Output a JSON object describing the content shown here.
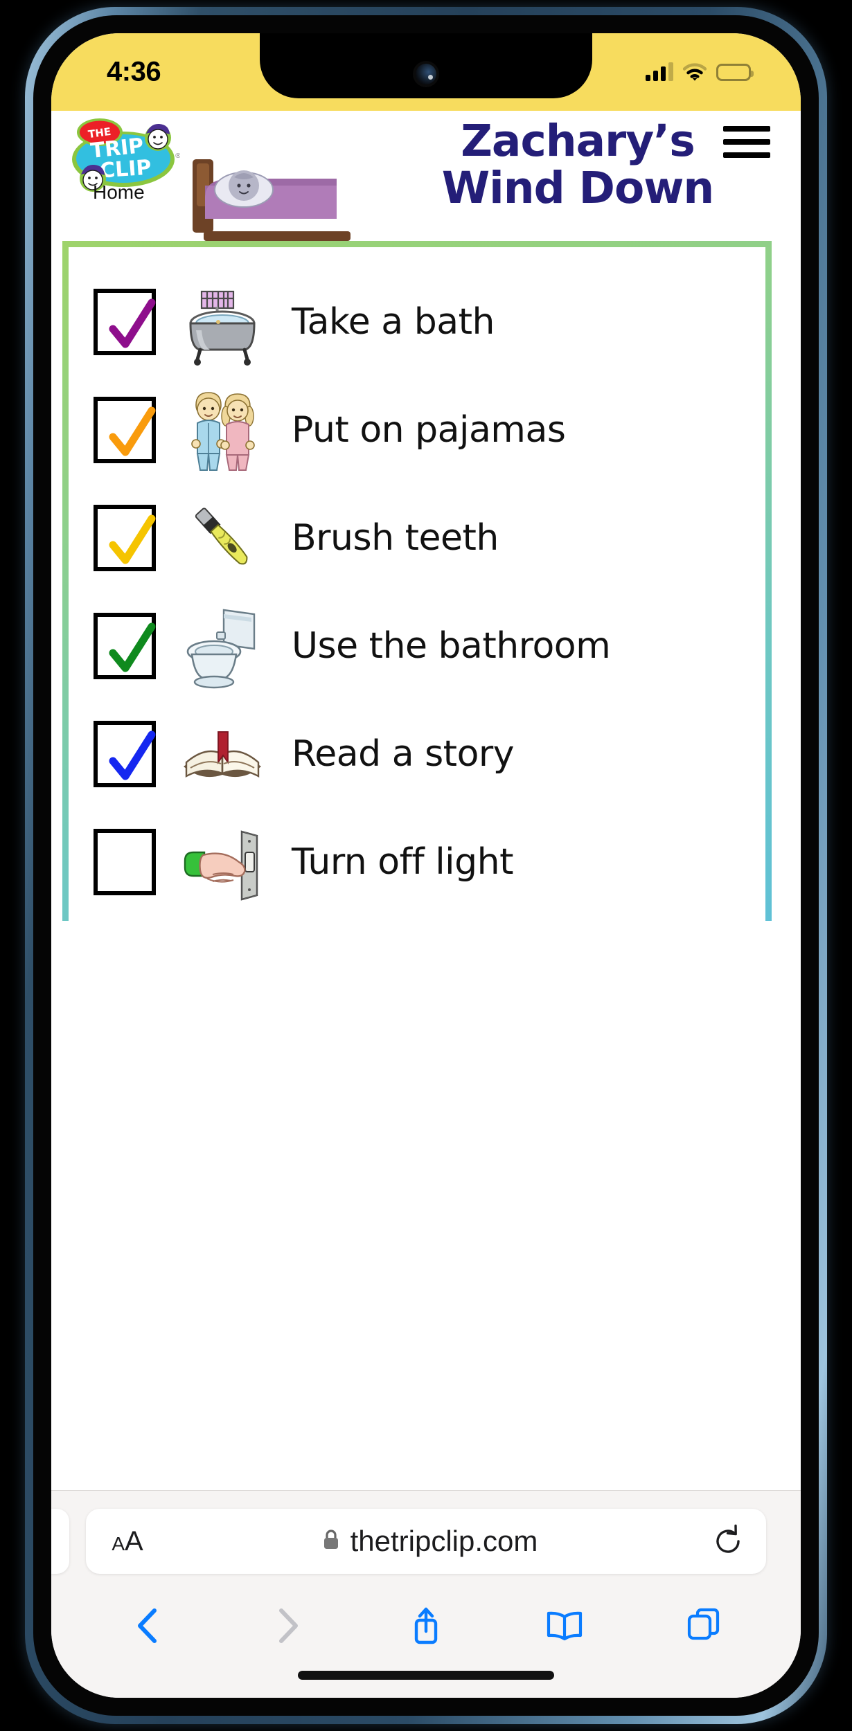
{
  "device": {
    "status_bar": {
      "time": "4:36",
      "signal_icon": "cellular-signal-icon",
      "signal_bars_filled": 3,
      "signal_bars_total": 4,
      "wifi_icon": "wifi-icon",
      "battery_icon": "battery-icon",
      "battery_level_percent": 25,
      "battery_color": "#fb2e28",
      "background_color": "#f7dc5e"
    }
  },
  "site": {
    "logo": {
      "name": "the-trip-clip-logo",
      "line1": "THE",
      "line2": "TRIP",
      "line3": "CLIP",
      "registered_mark": "®"
    },
    "home_link": "Home",
    "menu_icon": "hamburger-menu-icon"
  },
  "header": {
    "title_line1": "Zachary’s",
    "title_line2": "Wind Down",
    "title_color": "#241e78",
    "header_art": "bed-with-sleeping-child-illustration"
  },
  "card": {
    "border_colors": [
      "#9ed36b",
      "#6fc8c2",
      "#56bcdf"
    ],
    "items": [
      {
        "label": "Take a bath",
        "checked": true,
        "check_color": "#8e0e8c",
        "icon": "bathtub-icon"
      },
      {
        "label": "Put on pajamas",
        "checked": true,
        "check_color": "#f99b0c",
        "icon": "children-in-pajamas-icon"
      },
      {
        "label": "Brush teeth",
        "checked": true,
        "check_color": "#f5c400",
        "icon": "toothbrush-icon"
      },
      {
        "label": "Use the bathroom",
        "checked": true,
        "check_color": "#0f8a1e",
        "icon": "toilet-icon"
      },
      {
        "label": "Read a story",
        "checked": true,
        "check_color": "#1527f0",
        "icon": "open-book-icon"
      },
      {
        "label": "Turn off light",
        "checked": false,
        "check_color": "",
        "icon": "hand-on-light-switch-icon"
      }
    ]
  },
  "browser": {
    "text_size_small": "A",
    "text_size_large": "A",
    "lock_icon": "lock-icon",
    "url": "thetripclip.com",
    "reload_icon": "reload-icon",
    "nav": [
      {
        "name": "back-button",
        "icon": "chevron-left-icon",
        "enabled": true
      },
      {
        "name": "forward-button",
        "icon": "chevron-right-icon",
        "enabled": false
      },
      {
        "name": "share-button",
        "icon": "share-icon",
        "enabled": true
      },
      {
        "name": "bookmarks-button",
        "icon": "book-icon",
        "enabled": true
      },
      {
        "name": "tabs-button",
        "icon": "tabs-icon",
        "enabled": true
      }
    ],
    "accent_color": "#0a7cff"
  }
}
